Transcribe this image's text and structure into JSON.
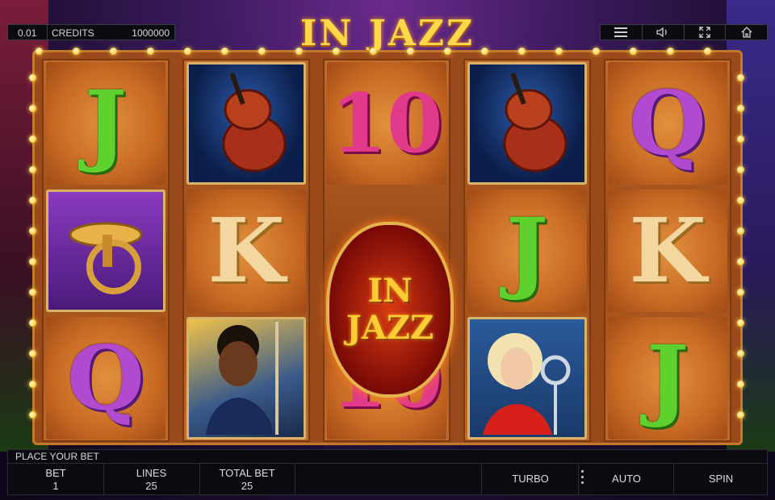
{
  "header": {
    "denomination": "0.01",
    "credits_label": "CREDITS",
    "credits_value": "1000000",
    "logo": "IN JAZZ",
    "menu_icons": [
      "menu-icon",
      "sound-icon",
      "fullscreen-icon",
      "home-icon"
    ]
  },
  "reels": [
    [
      "J",
      "horn-picture",
      "Q"
    ],
    [
      "cello-picture",
      "K",
      "musician-picture"
    ],
    [
      "10",
      "wild-in-jazz",
      "10"
    ],
    [
      "cello-picture",
      "J",
      "singer-picture"
    ],
    [
      "Q",
      "K",
      "J"
    ]
  ],
  "wild_badge": {
    "line1": "IN",
    "line2": "JAZZ"
  },
  "status": {
    "message": "PLACE YOUR BET"
  },
  "controls": {
    "bet_label": "BET",
    "bet_value": "1",
    "lines_label": "LINES",
    "lines_value": "25",
    "total_bet_label": "TOTAL BET",
    "total_bet_value": "25",
    "turbo": "TURBO",
    "auto": "AUTO",
    "spin": "SPIN"
  },
  "colors": {
    "accent_gold": "#ffd84a",
    "panel_bg": "#0a0a10"
  }
}
